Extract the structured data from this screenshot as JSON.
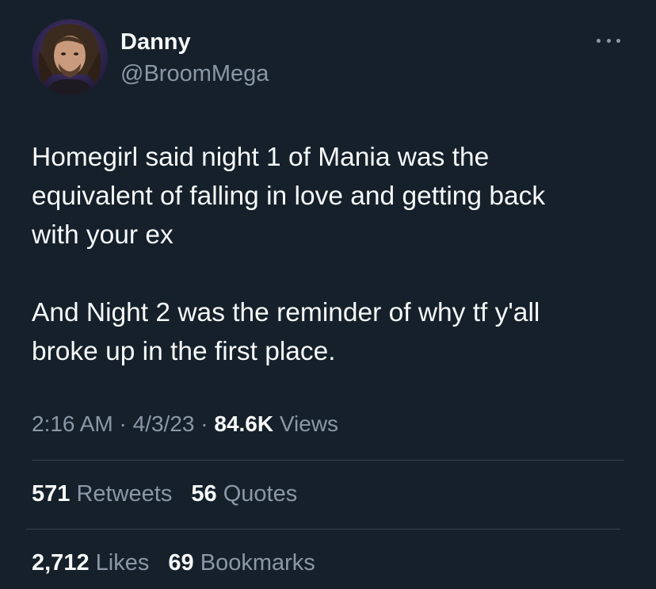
{
  "theme": {
    "background": "#15202b",
    "primary_text": "#f7f9f9",
    "secondary_text": "#8b98a5",
    "divider": "#38444d"
  },
  "author": {
    "display_name": "Danny",
    "handle": "@BroomMega",
    "avatar_icon": "profile-photo"
  },
  "tweet": {
    "paragraphs": [
      "Homegirl said night 1 of Mania was the\nequivalent of falling in love and getting back\nwith your ex",
      "And Night 2 was the reminder of why tf y'all\nbroke up in the first place."
    ]
  },
  "meta": {
    "time": "2:16 AM",
    "separator": "·",
    "date": "4/3/23",
    "views_count": "84.6K",
    "views_label": "Views"
  },
  "engagement": {
    "retweets_count": "571",
    "retweets_label": "Retweets",
    "quotes_count": "56",
    "quotes_label": "Quotes",
    "likes_count": "2,712",
    "likes_label": "Likes",
    "bookmarks_count": "69",
    "bookmarks_label": "Bookmarks"
  },
  "more_icon": "ellipsis-icon"
}
